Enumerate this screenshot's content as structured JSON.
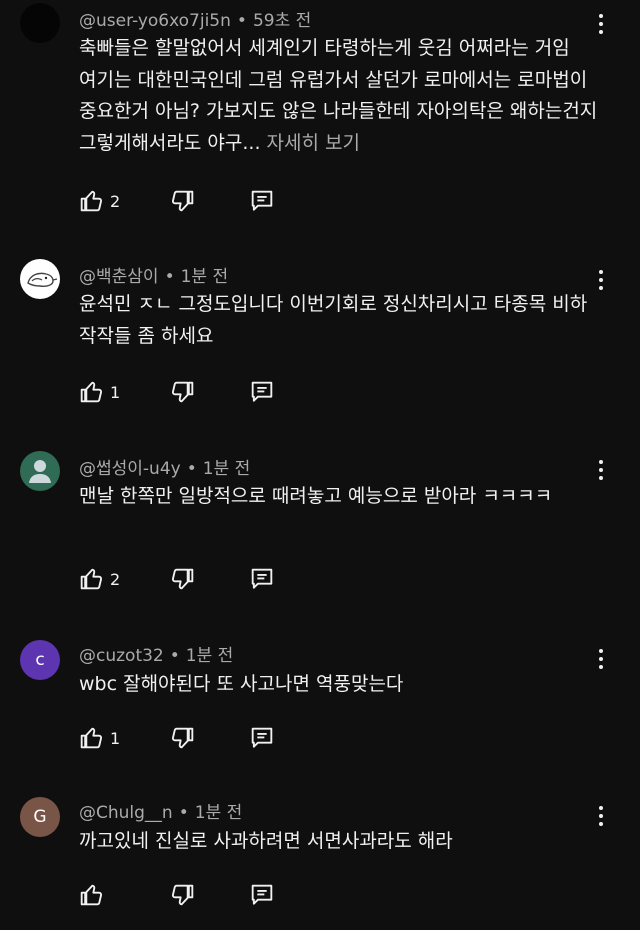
{
  "comments": [
    {
      "author": "@user-yo6xo7ji5n",
      "time": "59초 전",
      "text": "축빠들은 할말없어서 세계인기 타령하는게 웃김 어쩌라는 거임 여기는 대한민국인데 그럼 유럽가서 살던가 로마에서는 로마법이 중요한거 아님? 가보지도 않은 나라들한테 자아의탁은 왜하는건지 그렇게해서라도 야구...",
      "more_label": "자세히 보기",
      "likes": "2",
      "avatar_letter": "",
      "avatar_color": "#050505"
    },
    {
      "author": "@백춘삼이",
      "time": "1분 전",
      "text": "윤석민 ㅈㄴ 그정도입니다 이번기회로 정신차리시고 타종목 비하 작작들 좀 하세요",
      "likes": "1",
      "avatar_letter": "",
      "avatar_color": "#ffffff"
    },
    {
      "author": "@썹성이-u4y",
      "time": "1분 전",
      "text": "맨날 한쪽만 일방적으로 때려놓고 예능으로 받아라 ㅋㅋㅋㅋ",
      "likes": "2",
      "avatar_letter": "",
      "avatar_color": "#2f6b55"
    },
    {
      "author": "@cuzot32",
      "time": "1분 전",
      "text": "wbc 잘해야된다 또 사고나면 역풍맞는다",
      "likes": "1",
      "avatar_letter": "c",
      "avatar_color": "#5e35b1"
    },
    {
      "author": "@Chulg__n",
      "time": "1분 전",
      "text": "까고있네 진실로 사과하려면 서면사과라도 해라",
      "likes": "",
      "avatar_letter": "G",
      "avatar_color": "#795548"
    }
  ]
}
